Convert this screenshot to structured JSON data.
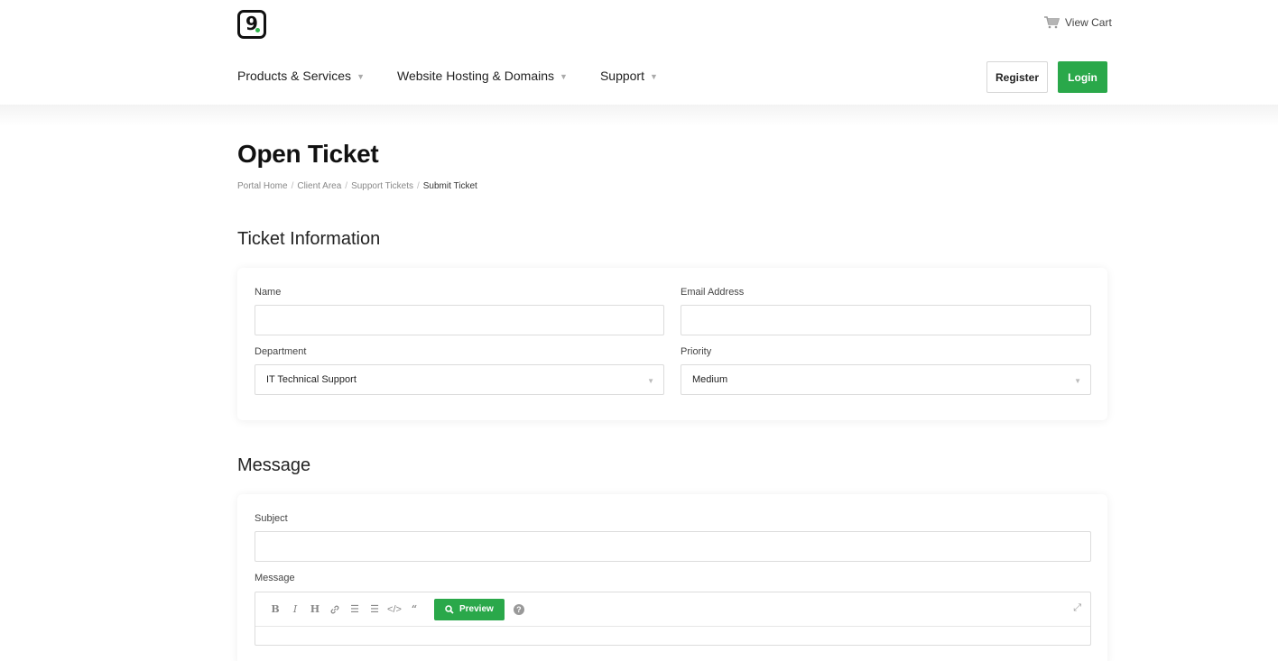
{
  "header": {
    "logo_text": "9",
    "cart_label": "View Cart",
    "nav": [
      {
        "label": "Products & Services"
      },
      {
        "label": "Website Hosting & Domains"
      },
      {
        "label": "Support"
      }
    ],
    "register_label": "Register",
    "login_label": "Login",
    "accent_color": "#2aa84a"
  },
  "page": {
    "title": "Open Ticket",
    "breadcrumb": [
      "Portal Home",
      "Client Area",
      "Support Tickets",
      "Submit Ticket"
    ]
  },
  "ticket_info": {
    "heading": "Ticket Information",
    "name_label": "Name",
    "name_value": "",
    "email_label": "Email Address",
    "email_value": "",
    "department_label": "Department",
    "department_value": "IT Technical Support",
    "priority_label": "Priority",
    "priority_value": "Medium"
  },
  "message": {
    "heading": "Message",
    "subject_label": "Subject",
    "subject_value": "",
    "message_label": "Message",
    "preview_label": "Preview",
    "toolbar_icons": [
      "bold-icon",
      "italic-icon",
      "heading-icon",
      "link-icon",
      "bullet-list-icon",
      "numbered-list-icon",
      "code-icon",
      "quote-icon"
    ],
    "help_text": "?"
  }
}
